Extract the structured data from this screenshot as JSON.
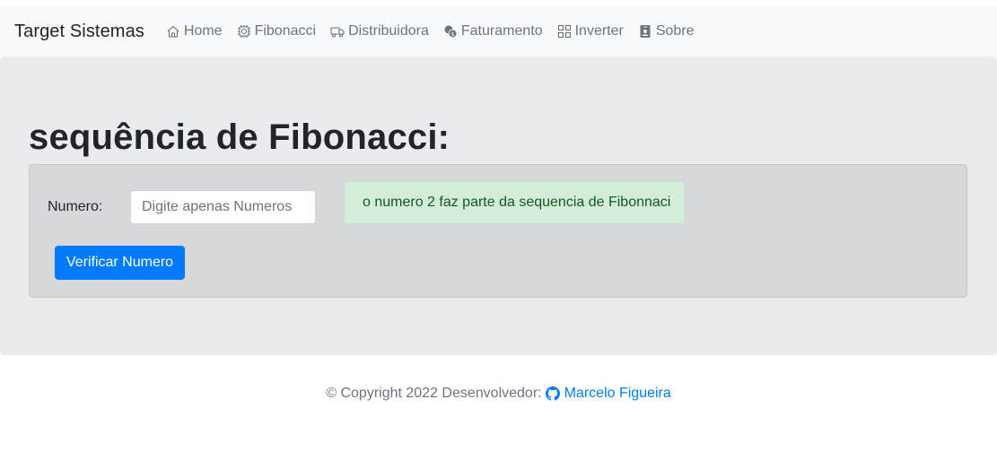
{
  "navbar": {
    "brand": "Target Sistemas",
    "items": [
      {
        "label": "Home",
        "icon": "house-icon"
      },
      {
        "label": "Fibonacci",
        "icon": "cpu-icon"
      },
      {
        "label": "Distribuidora",
        "icon": "truck-icon"
      },
      {
        "label": "Faturamento",
        "icon": "coins-icon"
      },
      {
        "label": "Inverter",
        "icon": "grid-icon"
      },
      {
        "label": "Sobre",
        "icon": "person-badge-icon"
      }
    ]
  },
  "main": {
    "title": "sequência de Fibonacci:",
    "form": {
      "label": "Numero:",
      "input_value": "",
      "input_placeholder": "Digite apenas Numeros",
      "button_label": "Verificar Numero"
    },
    "result": "o numero 2 faz parte da sequencia de Fibonnaci"
  },
  "footer": {
    "text": "© Copyright 2022 Desenvolvedor:",
    "author": "Marcelo Figueira",
    "author_icon": "github-icon"
  },
  "colors": {
    "primary": "#007bff",
    "success_bg": "#d4edda",
    "success_text": "#155724",
    "jumbotron_bg": "#e9ecef",
    "navbar_bg": "#f8f9fa"
  }
}
